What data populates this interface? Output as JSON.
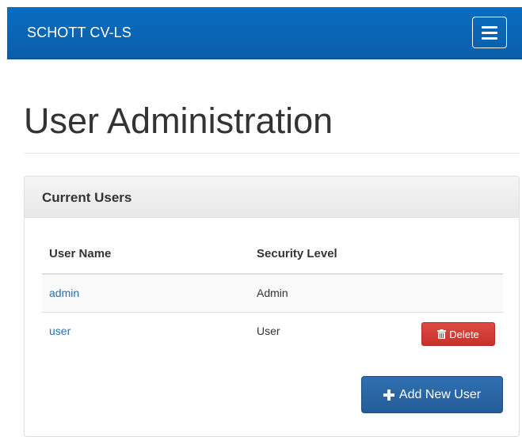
{
  "navbar": {
    "brand": "SCHOTT CV-LS",
    "toggle_icon": "hamburger-menu-icon",
    "color": "#0a66b4"
  },
  "page": {
    "title": "User Administration"
  },
  "panel": {
    "title": "Current Users",
    "columns": [
      "User Name",
      "Security Level"
    ],
    "rows": [
      {
        "name": "admin",
        "level": "Admin"
      },
      {
        "name": "user",
        "level": "User",
        "action": "Delete"
      }
    ],
    "delete_icon": "trash-icon",
    "add_button": {
      "label": "Add New User",
      "icon": "plus-icon"
    }
  },
  "colors": {
    "link": "#2a6fb3",
    "danger": "#d43f3a",
    "primary": "#2a67a8"
  }
}
